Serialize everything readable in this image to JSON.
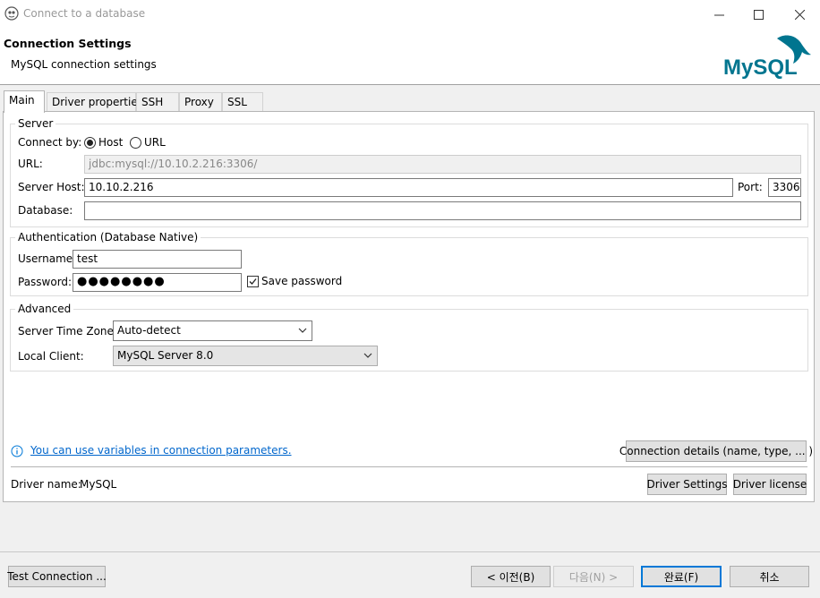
{
  "window": {
    "title": "Connect to a database"
  },
  "header": {
    "title": "Connection Settings",
    "subtitle": "MySQL connection settings",
    "logo_text": "MySQL"
  },
  "tabs": [
    {
      "label": "Main",
      "active": true
    },
    {
      "label": "Driver properties",
      "active": false
    },
    {
      "label": "SSH",
      "active": false
    },
    {
      "label": "Proxy",
      "active": false
    },
    {
      "label": "SSL",
      "active": false
    }
  ],
  "server": {
    "group_title": "Server",
    "connect_by_label": "Connect by:",
    "host_option": "Host",
    "url_option": "URL",
    "selected": "Host",
    "url_label": "URL:",
    "url_value": "jdbc:mysql://10.10.2.216:3306/",
    "host_label": "Server Host:",
    "host_value": "10.10.2.216",
    "port_label": "Port:",
    "port_value": "3306",
    "database_label": "Database:",
    "database_value": ""
  },
  "auth": {
    "group_title": "Authentication (Database Native)",
    "username_label": "Username:",
    "username_value": "test",
    "password_label": "Password:",
    "password_mask": "●●●●●●●●",
    "save_password_label": "Save password",
    "save_password_checked": true
  },
  "advanced": {
    "group_title": "Advanced",
    "timezone_label": "Server Time Zone:",
    "timezone_value": "Auto-detect",
    "client_label": "Local Client:",
    "client_value": "MySQL Server 8.0"
  },
  "info": {
    "variables_link": "You can use variables in connection parameters.",
    "details_button": "Connection details (name, type, ... )"
  },
  "driver": {
    "name_label": "Driver name:",
    "name_value": "MySQL",
    "settings_button": "Driver Settings",
    "license_button": "Driver license"
  },
  "footer": {
    "test_button": "Test Connection ...",
    "back_button": "< 이전(B)",
    "next_button": "다음(N) >",
    "finish_button": "완료(F)",
    "cancel_button": "취소"
  },
  "colors": {
    "accent": "#0078d7",
    "link": "#0066cc",
    "mysql_blue": "#00758f",
    "mysql_orange": "#f29111"
  }
}
